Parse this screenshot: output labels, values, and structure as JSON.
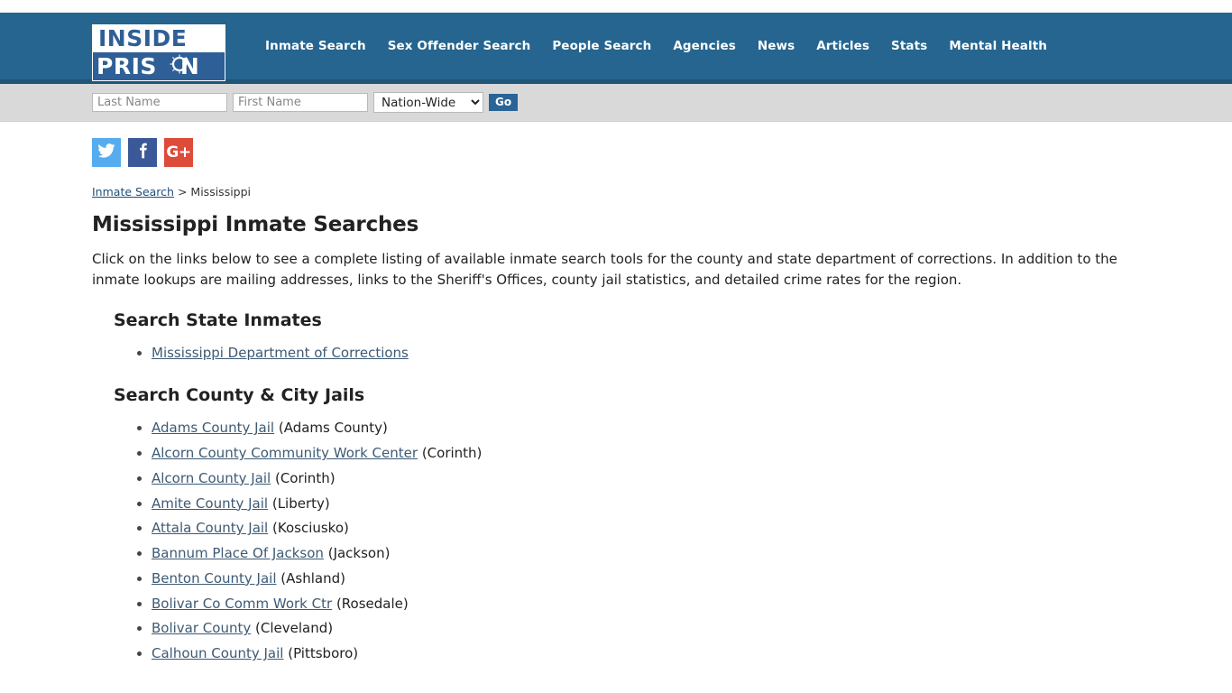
{
  "header": {
    "logo": {
      "line1": "INSIDE",
      "line2": "PRIS",
      "line3": "N",
      "ring_icon": "barbed-wire-ring-icon"
    },
    "nav": [
      {
        "label": "Inmate Search"
      },
      {
        "label": "Sex Offender Search"
      },
      {
        "label": "People Search"
      },
      {
        "label": "Agencies"
      },
      {
        "label": "News"
      },
      {
        "label": "Articles"
      },
      {
        "label": "Stats"
      },
      {
        "label": "Mental Health"
      }
    ],
    "colors": {
      "header_blue": "#25658f",
      "accent_blue": "#1f5577"
    }
  },
  "search": {
    "last_name_placeholder": "Last Name",
    "last_name_value": "",
    "first_name_placeholder": "First Name",
    "first_name_value": "",
    "scope_selected": "Nation-Wide",
    "scope_options": [
      "Nation-Wide"
    ],
    "go_label": "Go",
    "bar_color": "#d9d9d9",
    "go_color": "#2a6496"
  },
  "social": [
    {
      "name": "twitter-icon",
      "label": "Twitter",
      "color": "#55acee"
    },
    {
      "name": "facebook-icon",
      "label": "f",
      "color": "#3b5998"
    },
    {
      "name": "google-plus-icon",
      "label": "G+",
      "color": "#dd4b39"
    }
  ],
  "breadcrumb": {
    "link_label": "Inmate Search",
    "separator": ">",
    "current": "Mississippi"
  },
  "page": {
    "title": "Mississippi Inmate Searches",
    "intro": "Click on the links below to see a complete listing of available inmate search tools for the county and state department of corrections. In addition to the inmate lookups are mailing addresses, links to the Sheriff's Offices, county jail statistics, and detailed crime rates for the region."
  },
  "sections": [
    {
      "heading": "Search State Inmates",
      "items": [
        {
          "link": "Mississippi Department of Corrections",
          "location": ""
        }
      ]
    },
    {
      "heading": "Search County & City Jails",
      "items": [
        {
          "link": "Adams County Jail",
          "location": "(Adams County)"
        },
        {
          "link": "Alcorn County Community Work Center",
          "location": "(Corinth)"
        },
        {
          "link": "Alcorn County Jail",
          "location": "(Corinth)"
        },
        {
          "link": "Amite County Jail",
          "location": "(Liberty)"
        },
        {
          "link": "Attala County Jail",
          "location": "(Kosciusko)"
        },
        {
          "link": "Bannum Place Of Jackson",
          "location": "(Jackson)"
        },
        {
          "link": "Benton County Jail",
          "location": "(Ashland)"
        },
        {
          "link": "Bolivar Co Comm Work Ctr",
          "location": "(Rosedale)"
        },
        {
          "link": "Bolivar County",
          "location": "(Cleveland)"
        },
        {
          "link": "Calhoun County Jail",
          "location": "(Pittsboro)"
        }
      ]
    }
  ]
}
